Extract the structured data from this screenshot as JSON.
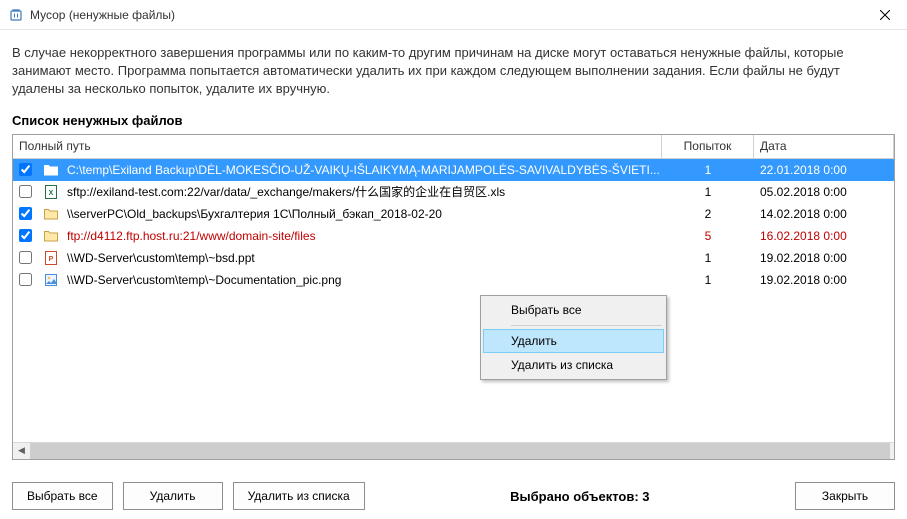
{
  "window": {
    "title": "Мусор (ненужные файлы)"
  },
  "description": "В случае некорректного завершения программы или по каким-то другим причинам на диске могут оставаться ненужные файлы, которые занимают место. Программа попытается автоматически удалить их при каждом следующем выполнении задания. Если файлы не будут удалены за несколько попыток, удалите их вручную.",
  "list_heading": "Список ненужных файлов",
  "columns": {
    "path": "Полный путь",
    "attempts": "Попыток",
    "date": "Дата"
  },
  "rows": [
    {
      "checked": true,
      "selected": true,
      "error": false,
      "icon": "folder",
      "path": "C:\\temp\\Exiland Backup\\DĖL-MOKESČIO-UŽ-VAIKŲ-IŠLAIKYMĄ-MARIJAMPOLĖS-SAVIVALDYBĖS-ŠVIETI...",
      "attempts": "1",
      "date": "22.01.2018  0:00"
    },
    {
      "checked": false,
      "selected": false,
      "error": false,
      "icon": "xls",
      "path": "sftp://exiland-test.com:22/var/data/_exchange/makers/什么国家的企业在自贸区.xls",
      "attempts": "1",
      "date": "05.02.2018  0:00"
    },
    {
      "checked": true,
      "selected": false,
      "error": false,
      "icon": "folder",
      "path": "\\\\serverPC\\Old_backups\\Бухгалтерия 1С\\Полный_бэкап_2018-02-20",
      "attempts": "2",
      "date": "14.02.2018  0:00"
    },
    {
      "checked": true,
      "selected": false,
      "error": true,
      "icon": "folder",
      "path": "ftp://d4112.ftp.host.ru:21/www/domain-site/files",
      "attempts": "5",
      "date": "16.02.2018  0:00"
    },
    {
      "checked": false,
      "selected": false,
      "error": false,
      "icon": "ppt",
      "path": "\\\\WD-Server\\custom\\temp\\~bsd.ppt",
      "attempts": "1",
      "date": "19.02.2018  0:00"
    },
    {
      "checked": false,
      "selected": false,
      "error": false,
      "icon": "png",
      "path": "\\\\WD-Server\\custom\\temp\\~Documentation_pic.png",
      "attempts": "1",
      "date": "19.02.2018  0:00"
    }
  ],
  "context_menu": {
    "select_all": "Выбрать все",
    "delete": "Удалить",
    "remove_from_list": "Удалить из списка"
  },
  "buttons": {
    "select_all": "Выбрать все",
    "delete": "Удалить",
    "remove_from_list": "Удалить из списка",
    "close": "Закрыть"
  },
  "selected_text": "Выбрано объектов: 3"
}
